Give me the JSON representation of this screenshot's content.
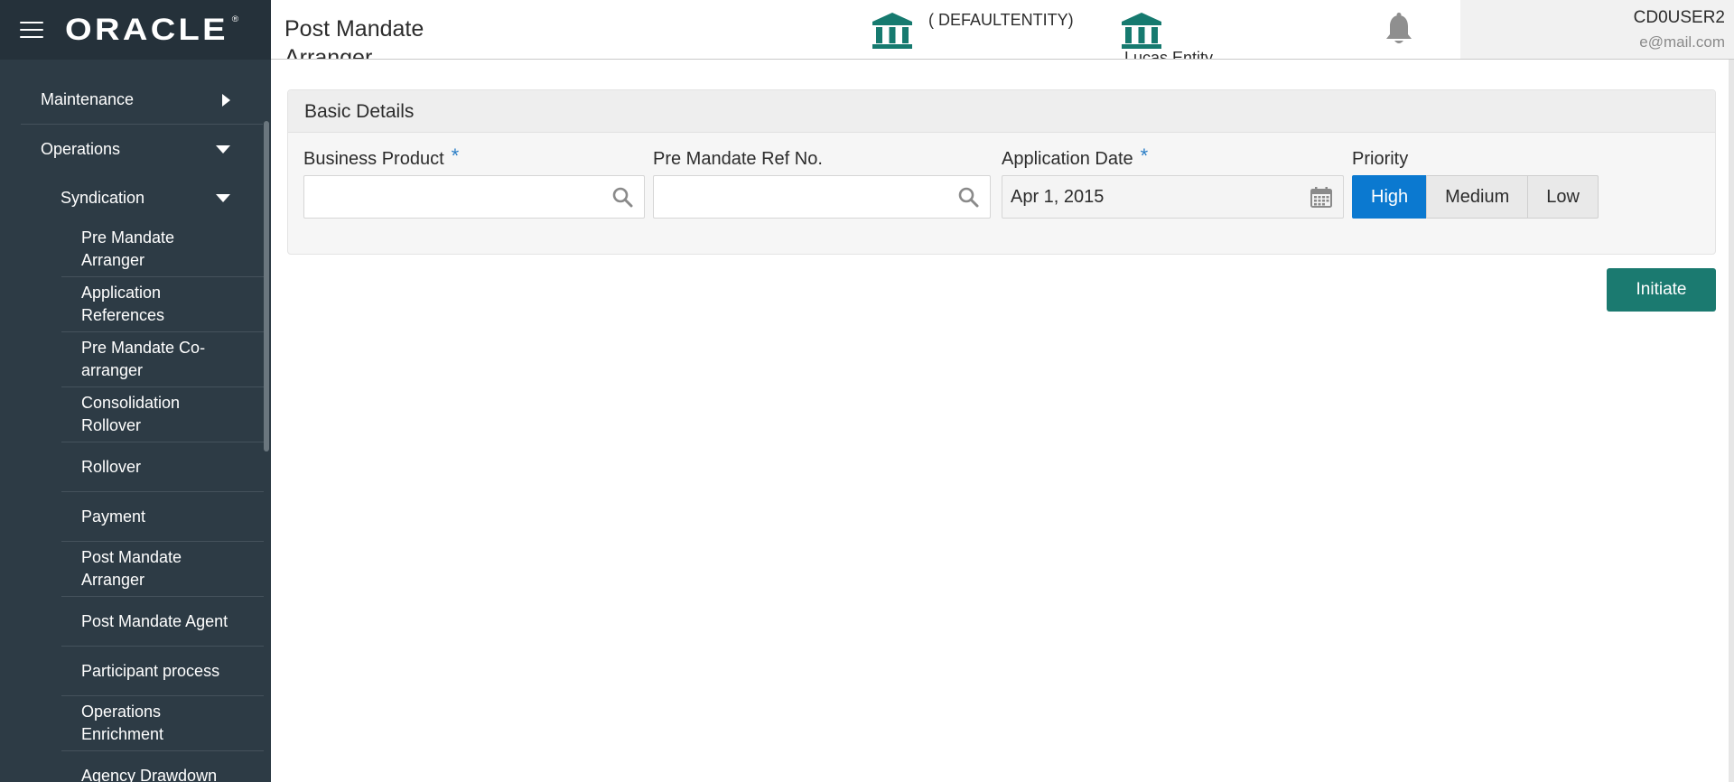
{
  "app": {
    "brand": "ORACLE",
    "brand_mark": "®"
  },
  "header": {
    "page_title": "Post Mandate Arranger",
    "entity": "( DEFAULTENTITY)",
    "entity_cut": "Lucas Entity",
    "user_name": "CD0USER2",
    "user_email": "e@mail.com"
  },
  "sidebar": {
    "items": [
      {
        "label": "Maintenance"
      },
      {
        "label": "Operations"
      }
    ],
    "syndication": {
      "label": "Syndication"
    },
    "sub_items": [
      {
        "label": "Pre Mandate Arranger"
      },
      {
        "label": "Application References"
      },
      {
        "label": "Pre Mandate Co-arranger"
      },
      {
        "label": "Consolidation Rollover"
      },
      {
        "label": "Rollover"
      },
      {
        "label": "Payment"
      },
      {
        "label": "Post Mandate Arranger"
      },
      {
        "label": "Post Mandate Agent"
      },
      {
        "label": "Participant process"
      },
      {
        "label": "Operations Enrichment"
      },
      {
        "label": "Agency Drawdown"
      }
    ]
  },
  "form": {
    "section_title": "Basic Details",
    "business_product": {
      "label": "Business Product",
      "required": "*",
      "value": ""
    },
    "pre_mandate_ref": {
      "label": "Pre Mandate Ref No.",
      "value": ""
    },
    "application_date": {
      "label": "Application Date",
      "required": "*",
      "value": "Apr 1, 2015"
    },
    "priority": {
      "label": "Priority",
      "options": [
        "High",
        "Medium",
        "Low"
      ],
      "selected": "High"
    },
    "initiate_label": "Initiate"
  },
  "colors": {
    "sidebar_bg": "#2d3b45",
    "accent_blue": "#0b79d0",
    "initiate_green": "#1b7a70",
    "bank_icon_teal": "#167a6f"
  },
  "icons": {
    "menu": "hamburger-icon",
    "entity": "bank-icon",
    "notifications": "bell-icon",
    "lookup": "search-icon",
    "date": "calendar-icon"
  }
}
